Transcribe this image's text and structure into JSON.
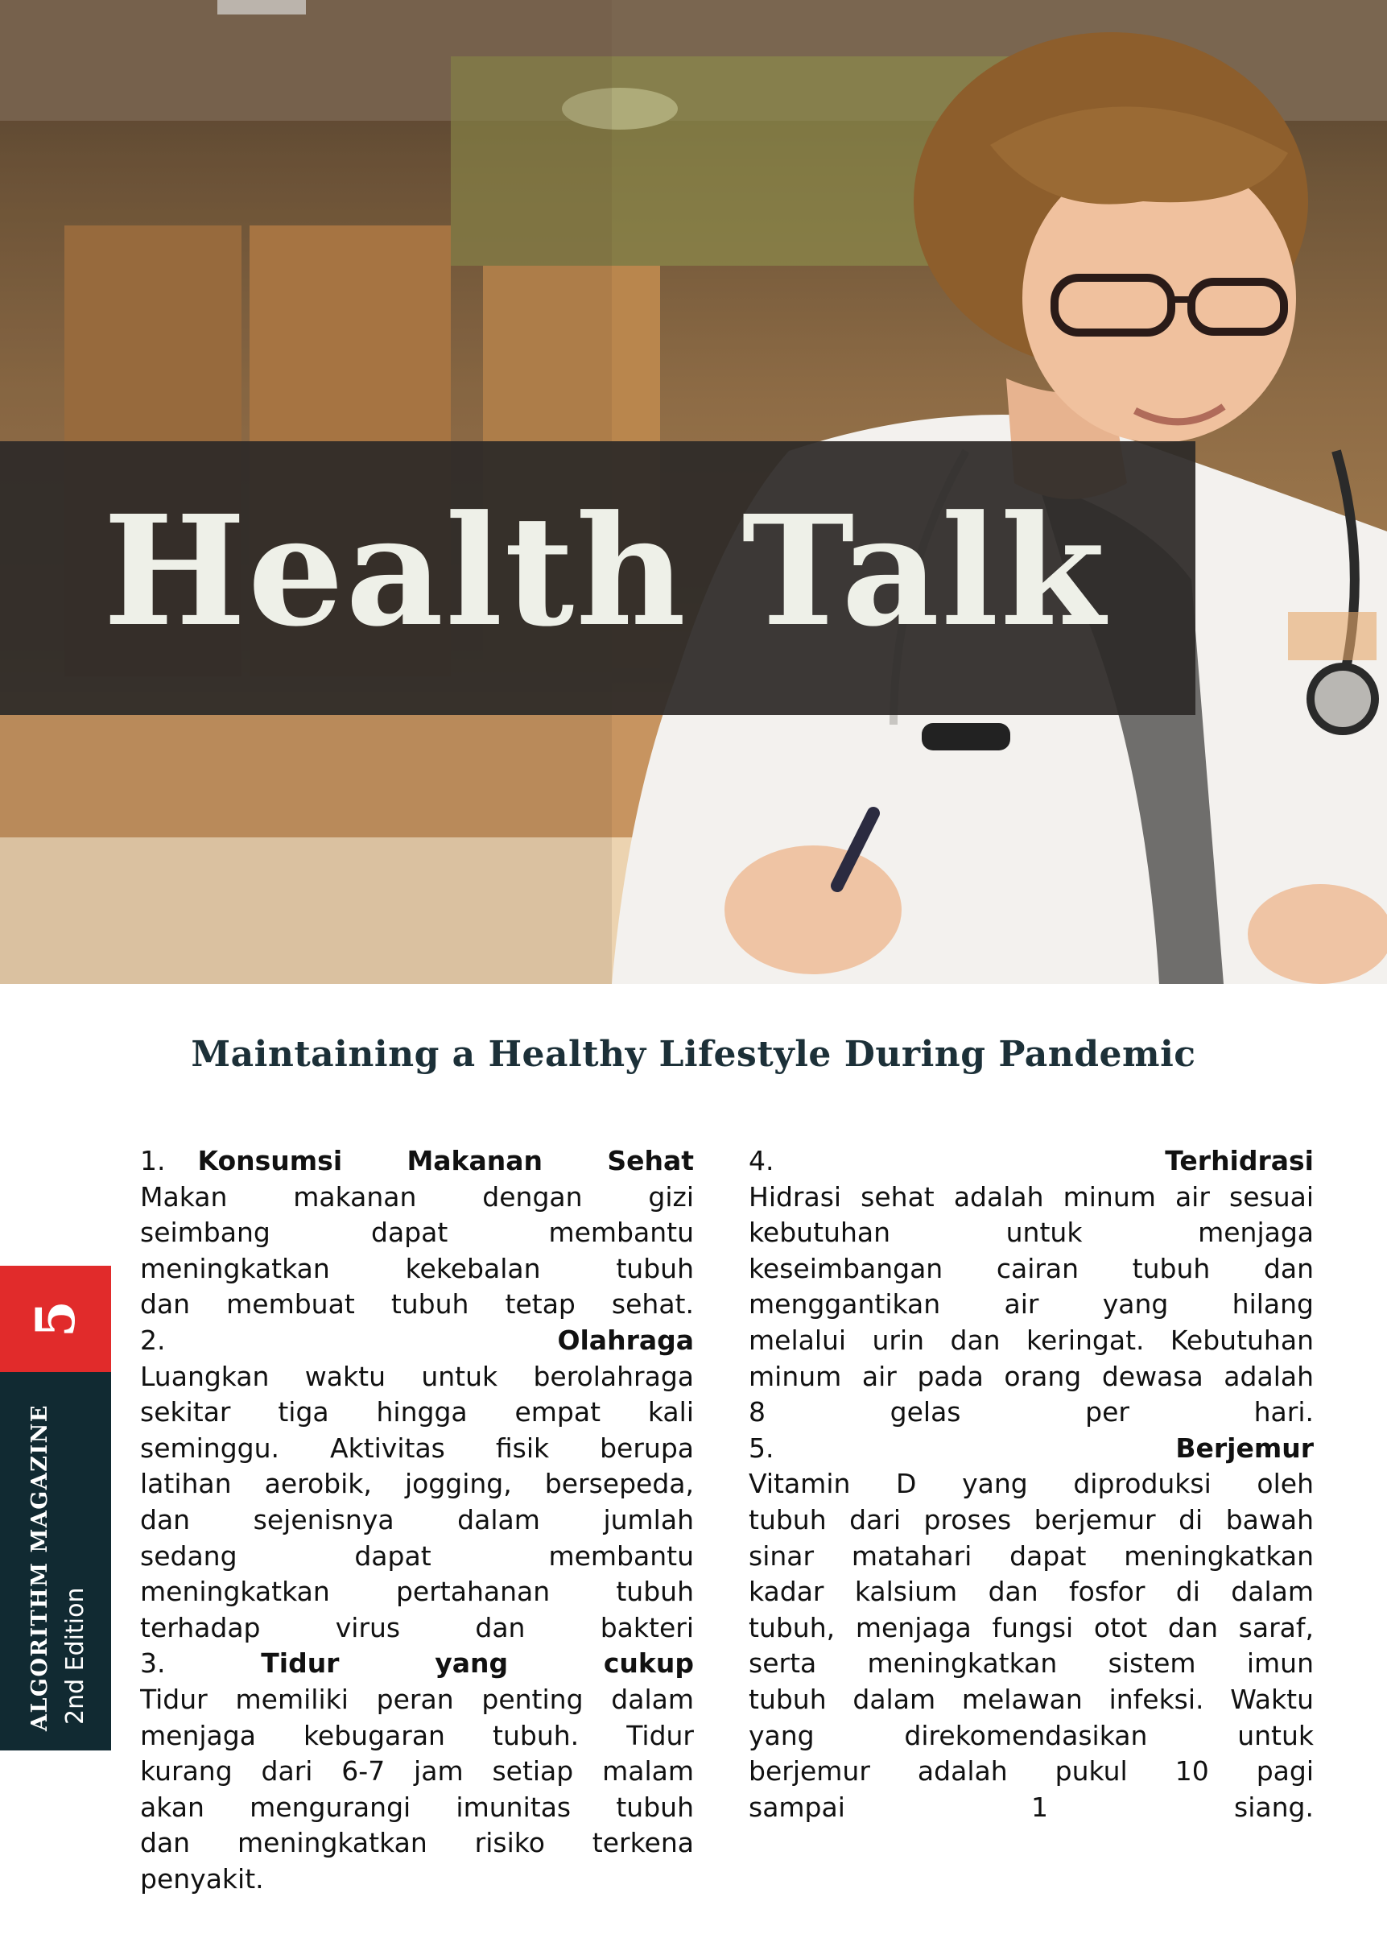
{
  "header": {
    "title": "Health Talk",
    "subtitle": "Maintaining a Healthy Lifestyle During Pandemic"
  },
  "side_tab": {
    "page_number": "5",
    "magazine": "ALGORITHM MAGAZINE",
    "edition": "2nd Edition"
  },
  "sections": [
    {
      "number": "1.",
      "heading": "Konsumsi Makanan Sehat",
      "lines": [
        "Makan makanan dengan gizi",
        "seimbang dapat membantu",
        "meningkatkan kekebalan tubuh",
        "dan membuat tubuh tetap sehat."
      ]
    },
    {
      "number": "2.",
      "heading": "Olahraga",
      "lines": [
        "Luangkan waktu untuk berolahraga",
        "sekitar tiga hingga empat kali",
        "seminggu. Aktivitas fisik berupa",
        "latihan aerobik, jogging, bersepeda,",
        "dan sejenisnya dalam jumlah",
        "sedang dapat membantu",
        "meningkatkan pertahanan tubuh",
        "terhadap virus dan bakteri"
      ]
    },
    {
      "number": "3.",
      "heading_words": [
        "Tidur",
        "yang",
        "cukup"
      ],
      "lines": [
        "Tidur memiliki peran penting dalam",
        "menjaga kebugaran tubuh. Tidur",
        "kurang dari 6-7 jam setiap malam",
        "akan mengurangi imunitas tubuh",
        "dan meningkatkan risiko terkena"
      ],
      "last_line": "penyakit."
    },
    {
      "number": "4.",
      "heading": "Terhidrasi",
      "lines": [
        "Hidrasi sehat adalah minum air sesuai",
        "kebutuhan untuk menjaga",
        "keseimbangan cairan tubuh dan",
        "menggantikan air yang hilang",
        "melalui urin dan keringat. Kebutuhan",
        "minum air pada orang dewasa adalah",
        "8 gelas per hari."
      ]
    },
    {
      "number": "5.",
      "heading": "Berjemur",
      "lines": [
        "Vitamin D yang diproduksi oleh",
        "tubuh dari proses berjemur di bawah",
        "sinar matahari dapat meningkatkan",
        "kadar kalsium dan fosfor di dalam",
        "tubuh, menjaga fungsi otot dan saraf,",
        "serta meningkatkan sistem imun",
        "tubuh dalam melawan infeksi. Waktu",
        "yang direkomendasikan untuk",
        "berjemur adalah pukul 10 pagi",
        "sampai 1 siang."
      ]
    }
  ]
}
